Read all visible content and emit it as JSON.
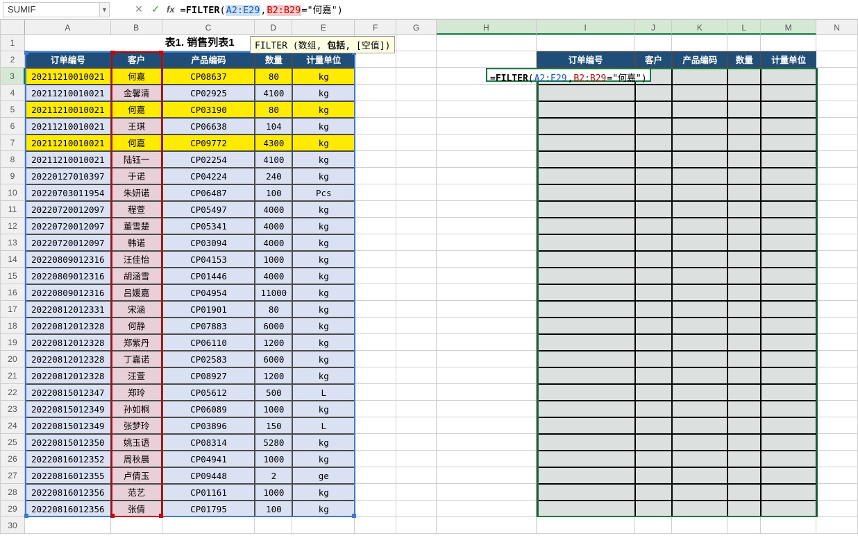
{
  "name_box": "SUMIF",
  "formula_parts": {
    "prefix": "=",
    "func": "FILTER",
    "open": "(",
    "arg1": "A2:E29",
    "sep1": ",",
    "arg2": "B2:B29",
    "tail": "=\"何嘉\")"
  },
  "func_hint": {
    "name": "FILTER",
    "p1": "(数组,",
    "p2_bold": "包括",
    "p3": ", [空值])"
  },
  "title": "表1. 销售列表1",
  "col_headers": [
    "A",
    "B",
    "C",
    "D",
    "E",
    "F",
    "G",
    "H",
    "I",
    "J",
    "K",
    "L",
    "M",
    "N"
  ],
  "row_headers_count": 30,
  "left_header": [
    "订单编号",
    "客户",
    "产品编码",
    "数量",
    "计量单位"
  ],
  "right_header": [
    "订单编号",
    "客户",
    "产品编码",
    "数量",
    "计量单位"
  ],
  "highlight_rows": [
    3,
    5,
    7
  ],
  "active_formula_display": "=FILTER(A2:E29,B2:B29=\"何嘉\")",
  "chart_data": {
    "type": "table",
    "columns": [
      "订单编号",
      "客户",
      "产品编码",
      "数量",
      "计量单位"
    ],
    "rows": [
      [
        "20211210010021",
        "何嘉",
        "CP08637",
        80,
        "kg"
      ],
      [
        "20211210010021",
        "金馨清",
        "CP02925",
        4100,
        "kg"
      ],
      [
        "20211210010021",
        "何嘉",
        "CP03190",
        80,
        "kg"
      ],
      [
        "20211210010021",
        "王琪",
        "CP06638",
        104,
        "kg"
      ],
      [
        "20211210010021",
        "何嘉",
        "CP09772",
        4300,
        "kg"
      ],
      [
        "20211210010021",
        "陆钰一",
        "CP02254",
        4100,
        "kg"
      ],
      [
        "20220127010397",
        "于诺",
        "CP04224",
        240,
        "kg"
      ],
      [
        "20220703011954",
        "朱妍诺",
        "CP06487",
        100,
        "Pcs"
      ],
      [
        "20220720012097",
        "程萱",
        "CP05497",
        4000,
        "kg"
      ],
      [
        "20220720012097",
        "董雪楚",
        "CP05341",
        4000,
        "kg"
      ],
      [
        "20220720012097",
        "韩诺",
        "CP03094",
        4000,
        "kg"
      ],
      [
        "20220809012316",
        "汪佳怡",
        "CP04153",
        1000,
        "kg"
      ],
      [
        "20220809012316",
        "胡涵雪",
        "CP01446",
        4000,
        "kg"
      ],
      [
        "20220809012316",
        "吕媛嘉",
        "CP04954",
        11000,
        "kg"
      ],
      [
        "20220812012331",
        "宋涵",
        "CP01901",
        80,
        "kg"
      ],
      [
        "20220812012328",
        "何静",
        "CP07883",
        6000,
        "kg"
      ],
      [
        "20220812012328",
        "郑紫丹",
        "CP06110",
        1200,
        "kg"
      ],
      [
        "20220812012328",
        "丁嘉诺",
        "CP02583",
        6000,
        "kg"
      ],
      [
        "20220812012328",
        "汪萱",
        "CP08927",
        1200,
        "kg"
      ],
      [
        "20220815012347",
        "郑玲",
        "CP05612",
        500,
        "L"
      ],
      [
        "20220815012349",
        "孙如桐",
        "CP06089",
        1000,
        "kg"
      ],
      [
        "20220815012349",
        "张梦玲",
        "CP03896",
        150,
        "L"
      ],
      [
        "20220815012350",
        "姚玉语",
        "CP08314",
        5280,
        "kg"
      ],
      [
        "20220816012352",
        "周秋晨",
        "CP04941",
        1000,
        "kg"
      ],
      [
        "20220816012355",
        "卢倩玉",
        "CP09448",
        2,
        "ge"
      ],
      [
        "20220816012356",
        "范艺",
        "CP01161",
        1000,
        "kg"
      ],
      [
        "20220816012356",
        "张倩",
        "CP01795",
        100,
        "kg"
      ]
    ]
  }
}
